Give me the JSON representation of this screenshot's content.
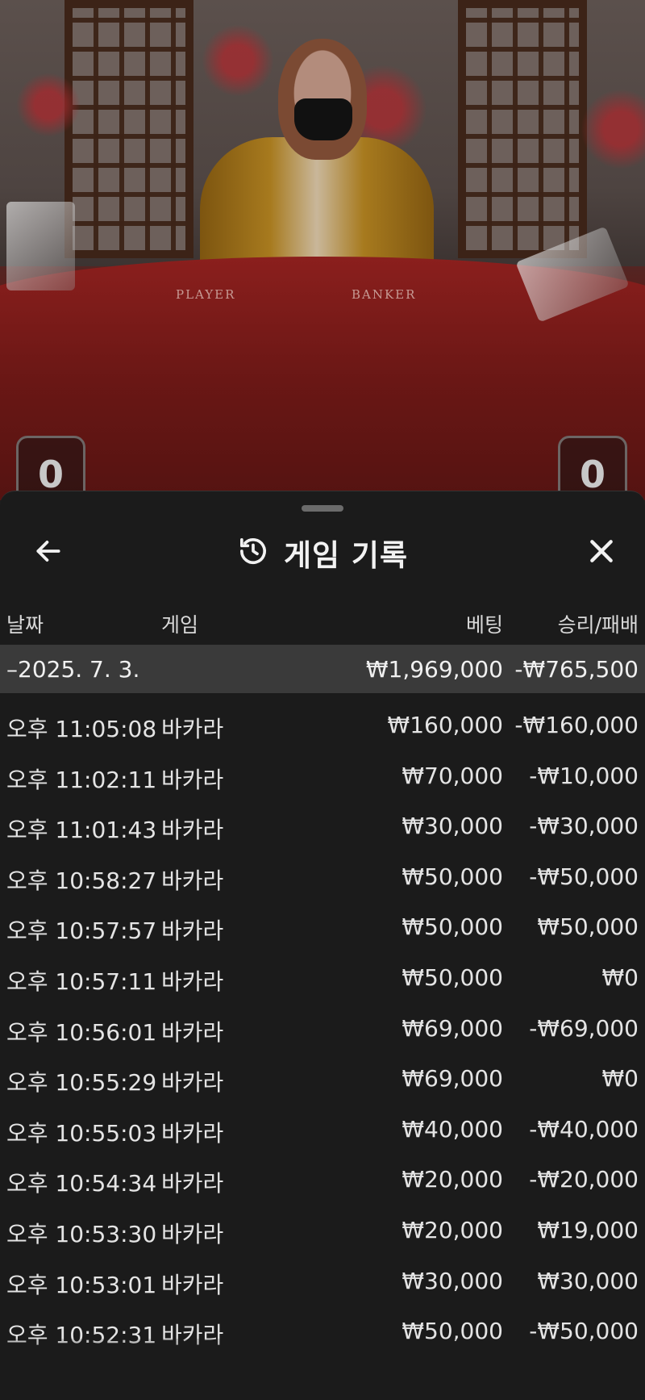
{
  "stream": {
    "player_label": "PLAYER",
    "banker_label": "BANKER",
    "player_score": "0",
    "banker_score": "0"
  },
  "sheet": {
    "title": "게임 기록",
    "icons": {
      "back": "arrow-left-icon",
      "history": "history-icon",
      "close": "close-icon"
    },
    "columns": {
      "date": "날짜",
      "game": "게임",
      "bet": "베팅",
      "result": "승리/패배"
    },
    "day_group": {
      "date": "–2025. 7. 3.",
      "bet": "₩1,969,000",
      "result": "-₩765,500"
    },
    "rows": [
      {
        "time": "오후 11:05:08",
        "game": "바카라",
        "bet": "₩160,000",
        "result": "-₩160,000"
      },
      {
        "time": "오후 11:02:11",
        "game": "바카라",
        "bet": "₩70,000",
        "result": "-₩10,000"
      },
      {
        "time": "오후 11:01:43",
        "game": "바카라",
        "bet": "₩30,000",
        "result": "-₩30,000"
      },
      {
        "time": "오후 10:58:27",
        "game": "바카라",
        "bet": "₩50,000",
        "result": "-₩50,000"
      },
      {
        "time": "오후 10:57:57",
        "game": "바카라",
        "bet": "₩50,000",
        "result": "₩50,000"
      },
      {
        "time": "오후 10:57:11",
        "game": "바카라",
        "bet": "₩50,000",
        "result": "₩0"
      },
      {
        "time": "오후 10:56:01",
        "game": "바카라",
        "bet": "₩69,000",
        "result": "-₩69,000"
      },
      {
        "time": "오후 10:55:29",
        "game": "바카라",
        "bet": "₩69,000",
        "result": "₩0"
      },
      {
        "time": "오후 10:55:03",
        "game": "바카라",
        "bet": "₩40,000",
        "result": "-₩40,000"
      },
      {
        "time": "오후 10:54:34",
        "game": "바카라",
        "bet": "₩20,000",
        "result": "-₩20,000"
      },
      {
        "time": "오후 10:53:30",
        "game": "바카라",
        "bet": "₩20,000",
        "result": "₩19,000"
      },
      {
        "time": "오후 10:53:01",
        "game": "바카라",
        "bet": "₩30,000",
        "result": "₩30,000"
      },
      {
        "time": "오후 10:52:31",
        "game": "바카라",
        "bet": "₩50,000",
        "result": "-₩50,000"
      }
    ]
  }
}
